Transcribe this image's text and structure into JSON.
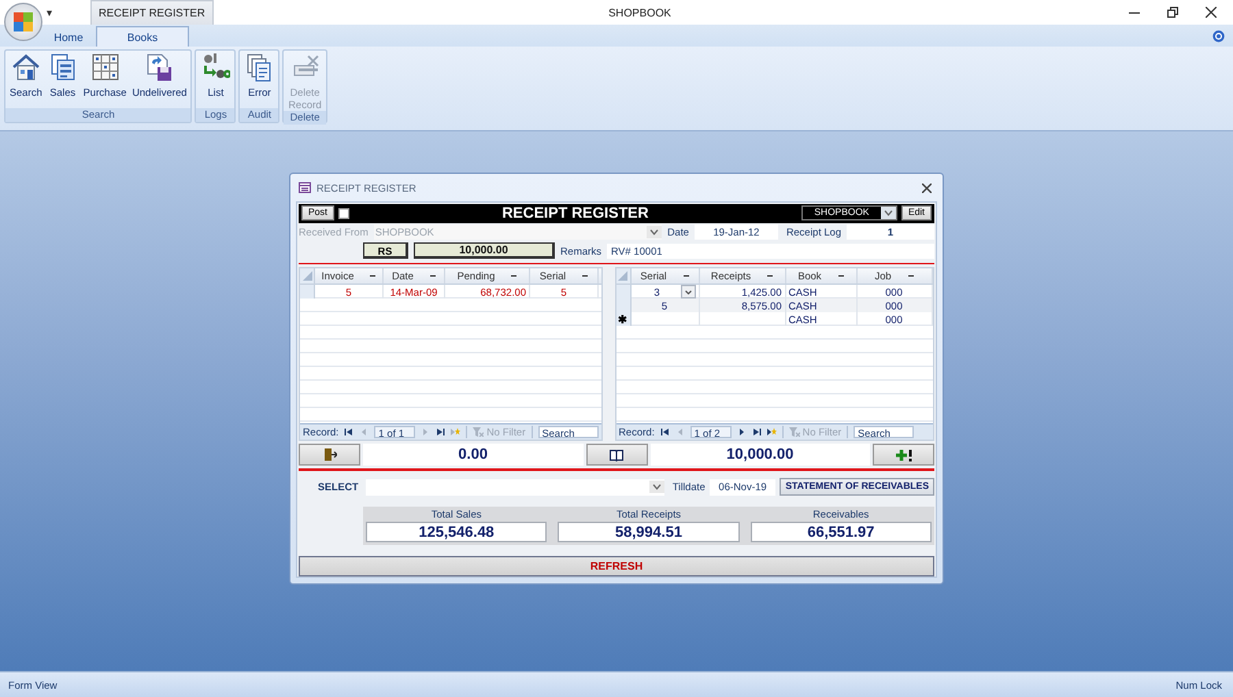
{
  "app": {
    "quick_access": "▾",
    "context_tab": "RECEIPT REGISTER",
    "title": "SHOPBOOK"
  },
  "tabs": [
    {
      "label": "Home",
      "selected": false
    },
    {
      "label": "Books",
      "selected": true
    }
  ],
  "ribbon": [
    {
      "label": "Search",
      "buttons": [
        {
          "label": "Search",
          "kind": "house",
          "disabled": false
        },
        {
          "label": "Sales",
          "kind": "documents",
          "disabled": false
        },
        {
          "label": "Purchase",
          "kind": "grid",
          "disabled": false
        },
        {
          "label": "Undelivered",
          "kind": "disk",
          "disabled": false
        }
      ]
    },
    {
      "label": "Logs",
      "buttons": [
        {
          "label": "List",
          "kind": "replace",
          "disabled": false
        }
      ]
    },
    {
      "label": "Audit",
      "buttons": [
        {
          "label": "Error",
          "kind": "pages",
          "disabled": false
        }
      ]
    },
    {
      "label": "Delete",
      "buttons": [
        {
          "label": "Delete Record",
          "kind": "pencil",
          "disabled": true
        }
      ]
    }
  ],
  "form": {
    "title": "RECEIPT REGISTER",
    "post": {
      "label": "Post",
      "checked": false
    },
    "heading": "RECEIPT REGISTER",
    "book": "SHOPBOOK",
    "edit": "Edit",
    "received_from": {
      "label": "Received From",
      "value": "SHOPBOOK",
      "disabled": true
    },
    "date": {
      "label": "Date",
      "value": "19-Jan-12"
    },
    "receipt_log": {
      "label": "Receipt Log",
      "value": "1"
    },
    "currency": "RS",
    "amount": "10,000.00",
    "remarks": {
      "label": "Remarks",
      "value": "RV# 10001"
    },
    "invoices": {
      "columns": [
        "Invoice",
        "Date",
        "Pending",
        "Serial"
      ],
      "rows": [
        {
          "cells": [
            "5",
            "14-Mar-09",
            "68,732.00",
            "5"
          ],
          "selected": false
        }
      ],
      "navigator": {
        "label": "Record:",
        "position": "1 of 1",
        "filter": "No Filter",
        "search": "Search",
        "buttons": [
          {
            "kind": "first",
            "disabled": false
          },
          {
            "kind": "prev",
            "disabled": true
          },
          {
            "kind": "next",
            "disabled": true
          },
          {
            "kind": "last",
            "disabled": false
          },
          {
            "kind": "new",
            "disabled": true
          }
        ]
      }
    },
    "receipts": {
      "columns": [
        "Serial",
        "Receipts",
        "Book",
        "Job"
      ],
      "rows": [
        {
          "cells": [
            "3",
            "1,425.00",
            "CASH",
            "000"
          ],
          "selected": true
        },
        {
          "cells": [
            "5",
            "8,575.00",
            "CASH",
            "000"
          ],
          "selected": false
        }
      ],
      "new_row": {
        "marker": "✱",
        "book": "CASH",
        "job": "000"
      },
      "navigator": {
        "label": "Record:",
        "position": "1 of 2",
        "filter": "No Filter",
        "search": "Search",
        "buttons": [
          {
            "kind": "first",
            "disabled": false
          },
          {
            "kind": "prev",
            "disabled": true
          },
          {
            "kind": "next",
            "disabled": false
          },
          {
            "kind": "last",
            "disabled": false
          },
          {
            "kind": "new",
            "disabled": false
          }
        ]
      }
    },
    "pending_total": "0.00",
    "receipt_total": "10,000.00",
    "select": {
      "label": "SELECT"
    },
    "tilldate": {
      "label": "Tilldate",
      "value": "06-Nov-19"
    },
    "statement": "STATEMENT OF RECEIVABLES",
    "summary": [
      {
        "label": "Total Sales",
        "value": "125,546.48"
      },
      {
        "label": "Total Receipts",
        "value": "58,994.51"
      },
      {
        "label": "Receivables",
        "value": "66,551.97"
      }
    ],
    "refresh": "REFRESH"
  },
  "status_bar": {
    "mode": "Form View",
    "indicator": "Num Lock"
  }
}
